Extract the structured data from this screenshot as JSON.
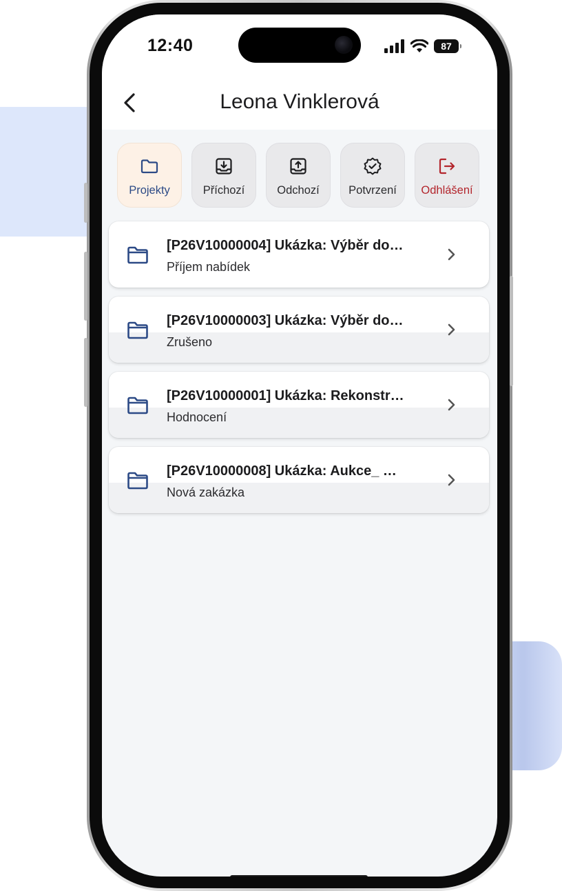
{
  "status_bar": {
    "time": "12:40",
    "battery": "87"
  },
  "header": {
    "title": "Leona Vinklerová"
  },
  "tabs": [
    {
      "label": "Projekty",
      "icon": "folder-icon",
      "active": true
    },
    {
      "label": "Příchozí",
      "icon": "inbox-download-icon",
      "active": false
    },
    {
      "label": "Odchozí",
      "icon": "outbox-upload-icon",
      "active": false
    },
    {
      "label": "Potvrzení",
      "icon": "verified-badge-icon",
      "active": false
    },
    {
      "label": "Odhlášení",
      "icon": "logout-icon",
      "active": false
    }
  ],
  "projects": [
    {
      "title": "[P26V10000004] Ukázka: Výběr do…",
      "status": "Příjem nabídek"
    },
    {
      "title": "[P26V10000003] Ukázka: Výběr do…",
      "status": "Zrušeno"
    },
    {
      "title": "[P26V10000001] Ukázka: Rekonstr…",
      "status": "Hodnocení"
    },
    {
      "title": "[P26V10000008] Ukázka: Aukce_ …",
      "status": "Nová zakázka"
    }
  ],
  "colors": {
    "accent": "#2c4a86",
    "logout": "#b3262d",
    "active_tab_bg": "#fdf1e6"
  }
}
